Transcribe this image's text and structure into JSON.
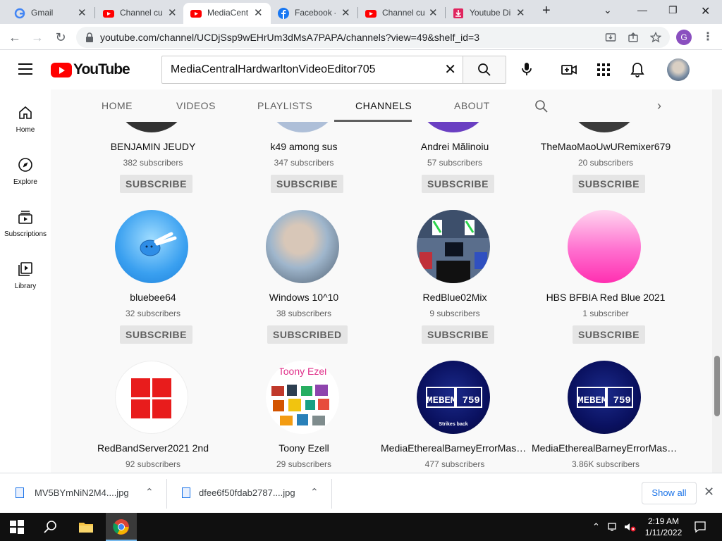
{
  "browser": {
    "tabs": [
      {
        "label": "Gmail",
        "icon": "gmail-icon"
      },
      {
        "label": "Channel cu",
        "icon": "youtube-icon"
      },
      {
        "label": "MediaCent",
        "icon": "youtube-icon",
        "active": true
      },
      {
        "label": "Facebook -",
        "icon": "facebook-icon"
      },
      {
        "label": "Channel cu",
        "icon": "youtube-icon"
      },
      {
        "label": "Youtube Di",
        "icon": "download-site-icon"
      }
    ],
    "new_tab": "+",
    "url": "youtube.com/channel/UCDjSsp9wEHrUm3dMsA7PAPA/channels?view=49&shelf_id=3",
    "profile_initial": "G"
  },
  "youtube": {
    "logo_text": "YouTube",
    "search_value": "MediaCentralHardwarltonVideoEditor705",
    "sidebar": [
      {
        "label": "Home",
        "icon": "home-icon"
      },
      {
        "label": "Explore",
        "icon": "compass-icon"
      },
      {
        "label": "Subscriptions",
        "icon": "subscriptions-icon"
      },
      {
        "label": "Library",
        "icon": "library-icon"
      }
    ],
    "channel_tabs": [
      {
        "label": "HOME"
      },
      {
        "label": "VIDEOS"
      },
      {
        "label": "PLAYLISTS"
      },
      {
        "label": "CHANNELS",
        "active": true
      },
      {
        "label": "ABOUT"
      }
    ],
    "channels": [
      {
        "name": "BENJAMIN JEUDY",
        "subs": "382 subscribers",
        "button": "SUBSCRIBE"
      },
      {
        "name": "k49 among sus",
        "subs": "347 subscribers",
        "button": "SUBSCRIBE"
      },
      {
        "name": "Andrei Mălinoiu",
        "subs": "57 subscribers",
        "button": "SUBSCRIBE"
      },
      {
        "name": "TheMaoMaoUwURemixer679",
        "subs": "20 subscribers",
        "button": "SUBSCRIBE"
      },
      {
        "name": "bluebee64",
        "subs": "32 subscribers",
        "button": "SUBSCRIBE"
      },
      {
        "name": "Windows 10^10",
        "subs": "38 subscribers",
        "button": "SUBSCRIBED"
      },
      {
        "name": "RedBlue02Mix",
        "subs": "9 subscribers",
        "button": "SUBSCRIBE"
      },
      {
        "name": "HBS BFBIA Red Blue 2021",
        "subs": "1 subscriber",
        "button": "SUBSCRIBE"
      },
      {
        "name": "RedBandServer2021 2nd",
        "subs": "92 subscribers"
      },
      {
        "name": "Toony Ezell",
        "subs": "29 subscribers",
        "avatar_text": "Toony Ezel"
      },
      {
        "name": "MediaEtherealBarneyErrorMast…",
        "subs": "477 subscribers",
        "avatar_text": "MEBEM 759",
        "avatar_caption": "Strikes back"
      },
      {
        "name": "MediaEtherealBarneyErrorMast…",
        "subs": "3.86K subscribers",
        "avatar_text": "MEBEM 759"
      }
    ]
  },
  "downloads": {
    "items": [
      {
        "name": "MV5BYmNiN2M4....jpg"
      },
      {
        "name": "dfee6f50fdab2787....jpg"
      }
    ],
    "show_all": "Show all"
  },
  "taskbar": {
    "time": "2:19 AM",
    "date": "1/11/2022"
  },
  "colors": {
    "youtube_red": "#ff0000",
    "link_blue": "#1a73e8",
    "taskbar": "#101010"
  }
}
